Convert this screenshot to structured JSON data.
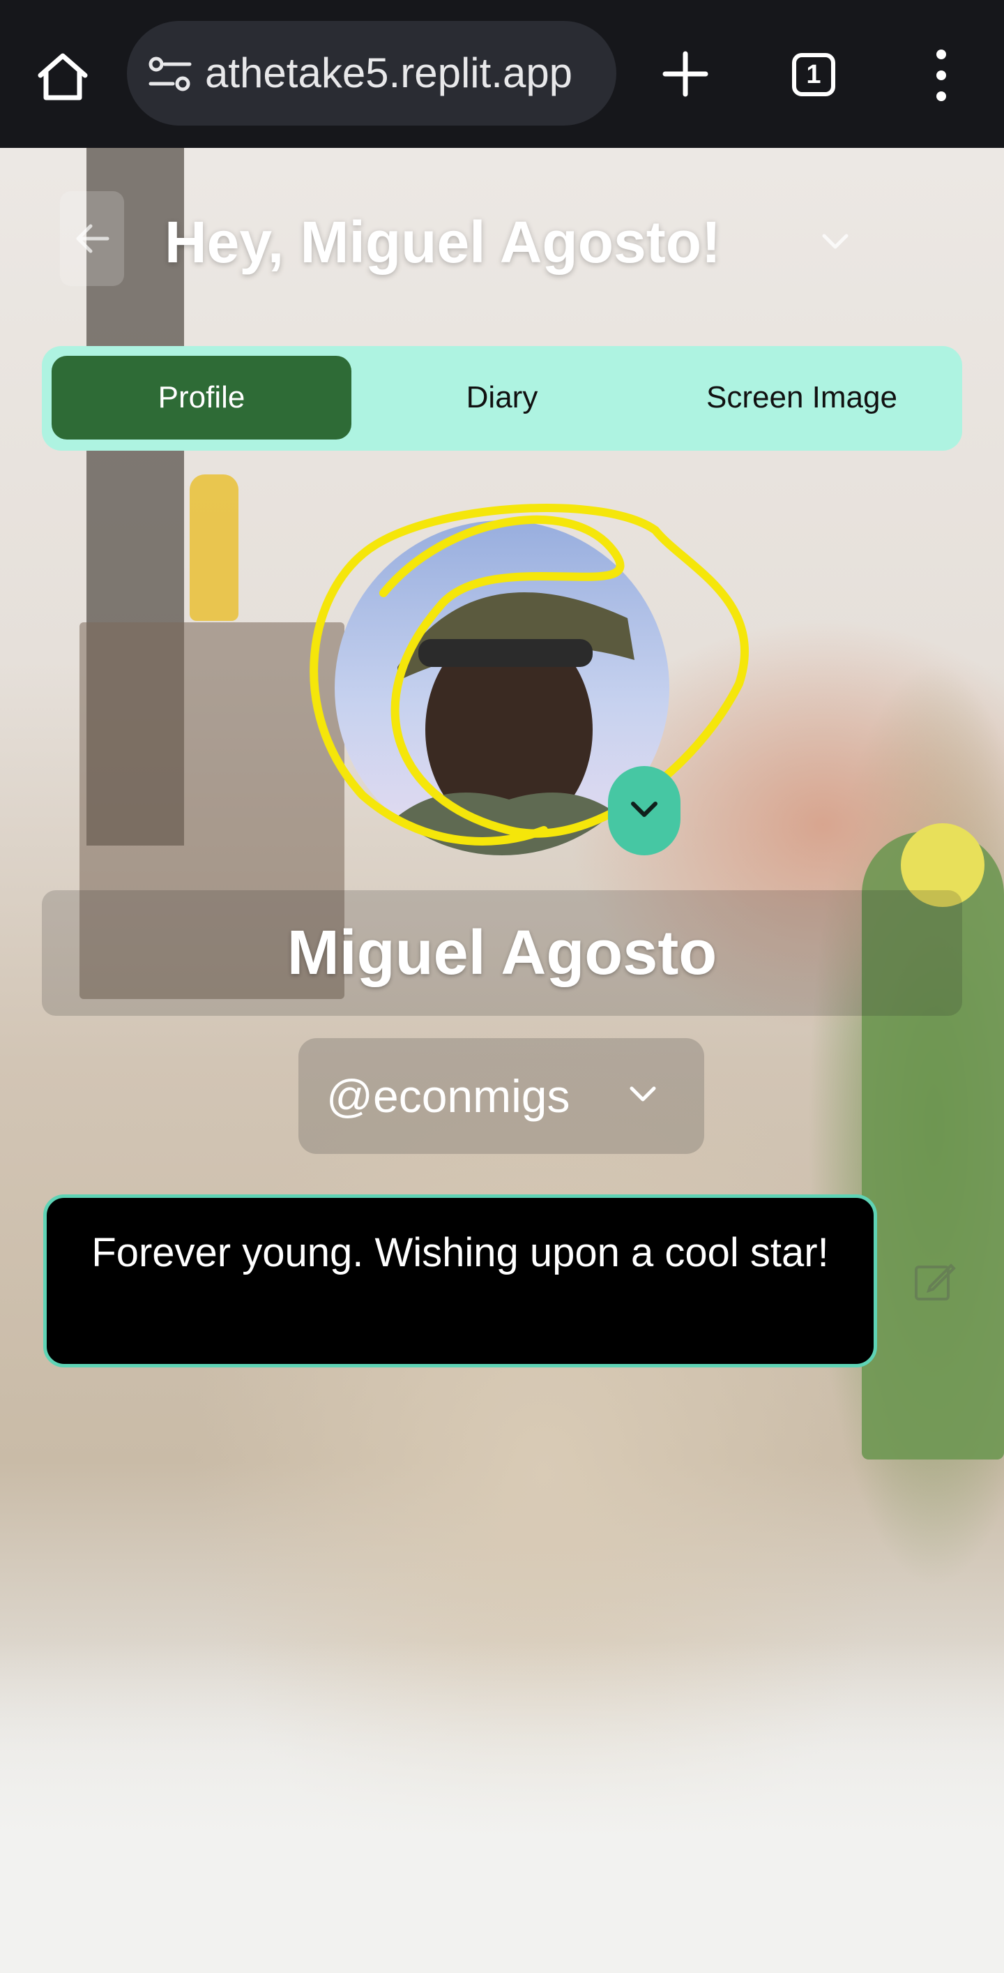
{
  "browser": {
    "url": "athetake5.replit.app",
    "tab_count": "1"
  },
  "header": {
    "greeting": "Hey, Miguel Agosto!"
  },
  "tabs": [
    {
      "label": "Profile",
      "active": true
    },
    {
      "label": "Diary",
      "active": false
    },
    {
      "label": "Screen Image",
      "active": false
    }
  ],
  "profile": {
    "name": "Miguel Agosto",
    "handle": "@econmigs",
    "bio": "Forever young. Wishing upon a cool star!"
  },
  "colors": {
    "tab_bar": "#aef3e1",
    "tab_active": "#2e6b36",
    "bio_border": "#5fd3b5",
    "toggle": "#46c7a3",
    "scribble": "#f5e60a"
  },
  "icons": [
    "home-icon",
    "site-settings-icon",
    "new-tab-icon",
    "tab-switcher-icon",
    "more-menu-icon",
    "back-arrow-icon",
    "chevron-down-icon",
    "edit-icon"
  ]
}
